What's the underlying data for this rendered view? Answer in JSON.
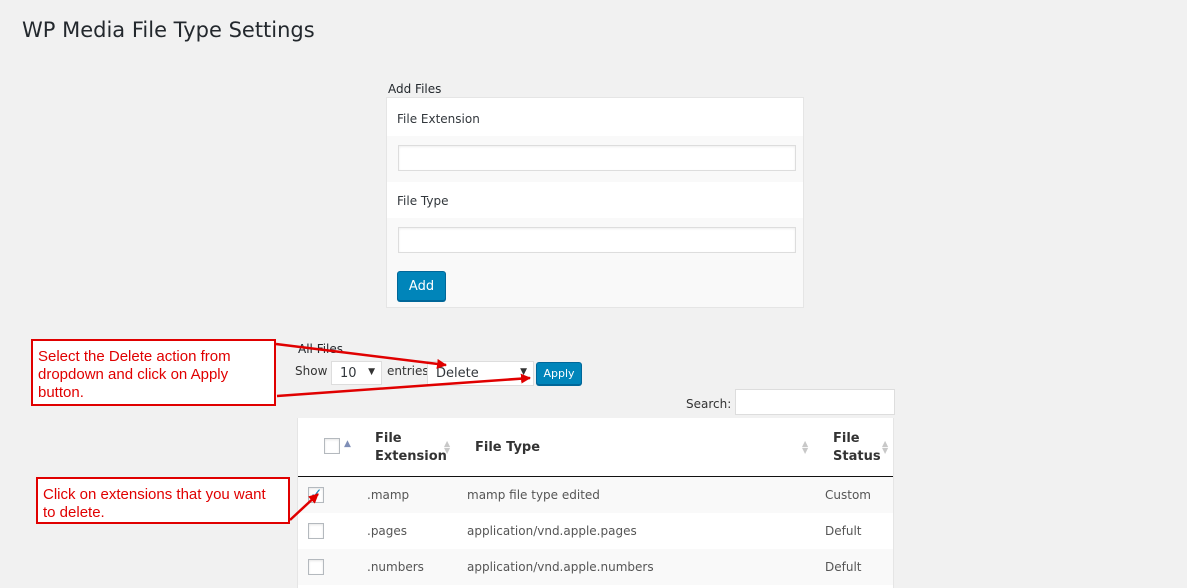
{
  "page": {
    "title": "WP Media File Type Settings"
  },
  "add_files": {
    "section_title": "Add Files",
    "extension_label": "File Extension",
    "extension_value": "",
    "type_label": "File Type",
    "type_value": "",
    "add_button": "Add"
  },
  "all_files": {
    "section_title": "All Files",
    "show_label": "Show",
    "entries_value": "10",
    "entries_label": "entries",
    "bulk_action_value": "Delete",
    "apply_button": "Apply",
    "search_label": "Search:",
    "search_value": ""
  },
  "table": {
    "columns": {
      "extension_line1": "File",
      "extension_line2": "Extension",
      "type": "File Type",
      "status_line1": "File",
      "status_line2": "Status"
    },
    "rows": [
      {
        "checked": true,
        "extension": ".mamp",
        "type": "mamp file type edited",
        "status": "Custom"
      },
      {
        "checked": false,
        "extension": ".pages",
        "type": "application/vnd.apple.pages",
        "status": "Defult"
      },
      {
        "checked": false,
        "extension": ".numbers",
        "type": "application/vnd.apple.numbers",
        "status": "Defult"
      }
    ]
  },
  "annotations": {
    "callout_delete": "Select the Delete action from dropdown and click on Apply button.",
    "callout_extensions": "Click on extensions that you want to delete."
  },
  "colors": {
    "primary_button": "#0085ba",
    "annotation_red": "#e00000",
    "page_background": "#f1f1f1"
  }
}
